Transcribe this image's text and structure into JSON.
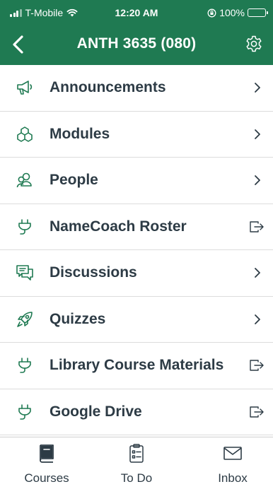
{
  "status_bar": {
    "carrier": "T-Mobile",
    "time": "12:20 AM",
    "battery": "100%"
  },
  "nav": {
    "title": "ANTH 3635 (080)",
    "back_icon": "chevron-left-icon",
    "settings_icon": "gear-icon"
  },
  "menu": {
    "items": [
      {
        "label": "Announcements",
        "icon": "megaphone-icon",
        "trailing": "chevron-right-icon"
      },
      {
        "label": "Modules",
        "icon": "modules-icon",
        "trailing": "chevron-right-icon"
      },
      {
        "label": "People",
        "icon": "people-icon",
        "trailing": "chevron-right-icon"
      },
      {
        "label": "NameCoach Roster",
        "icon": "plug-icon",
        "trailing": "external-link-icon"
      },
      {
        "label": "Discussions",
        "icon": "discussion-icon",
        "trailing": "chevron-right-icon"
      },
      {
        "label": "Quizzes",
        "icon": "rocket-icon",
        "trailing": "chevron-right-icon"
      },
      {
        "label": "Library Course Materials",
        "icon": "plug-icon",
        "trailing": "external-link-icon"
      },
      {
        "label": "Google Drive",
        "icon": "plug-icon",
        "trailing": "external-link-icon"
      }
    ]
  },
  "tabs": [
    {
      "label": "Courses",
      "icon": "courses-book-icon",
      "active": true
    },
    {
      "label": "To Do",
      "icon": "todo-clipboard-icon",
      "active": false
    },
    {
      "label": "Inbox",
      "icon": "inbox-envelope-icon",
      "active": false
    }
  ],
  "colors": {
    "header": "#1f7a52",
    "accent_icon": "#1f7a52",
    "text": "#2d3b45",
    "muted_icon": "#2d3b45"
  }
}
